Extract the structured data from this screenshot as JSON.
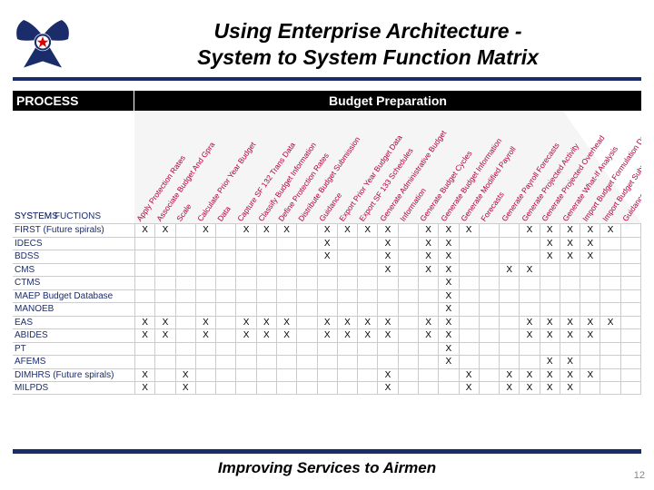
{
  "title_line1": "Using Enterprise Architecture -",
  "title_line2": "System to System Function Matrix",
  "header_left": "PROCESS",
  "header_right": "Budget Preparation",
  "system_functions_label": "SYSTEM FUCTIONS",
  "systems_label": "SYSTEMS",
  "functions": [
    "Apply Protection Rates",
    "Associate Budget And Gpra",
    "Scale",
    "Calculate Prior Year Budget",
    "Data",
    "Capture SF 132 Trans Data",
    "Classify Budget Information",
    "Define Protection Rates",
    "Distribute Budget Submission",
    "Guidance",
    "Export Prior Year Budget Data",
    "Export SF 133 Schedules",
    "Generate Administrative Budget",
    "Information",
    "Generate Budget Cycles",
    "Generate Budget Information",
    "Generate Modified Payroll",
    "Forecasts",
    "Generate Payroll Forecasts",
    "Generate Projected Activity",
    "Generate Projected Overhead",
    "Generate What-If Analysis",
    "Import Budget Formulation Data",
    "Import Budget Submission",
    "Guidance"
  ],
  "systems": [
    {
      "name": "FIRST (Future spirals)",
      "marks": [
        1,
        1,
        0,
        1,
        0,
        1,
        1,
        1,
        0,
        1,
        1,
        1,
        1,
        0,
        1,
        1,
        1,
        0,
        0,
        1,
        1,
        1,
        1,
        1,
        0
      ]
    },
    {
      "name": "IDECS",
      "marks": [
        0,
        0,
        0,
        0,
        0,
        0,
        0,
        0,
        0,
        1,
        0,
        0,
        1,
        0,
        1,
        1,
        0,
        0,
        0,
        0,
        1,
        1,
        1,
        0,
        0
      ]
    },
    {
      "name": "BDSS",
      "marks": [
        0,
        0,
        0,
        0,
        0,
        0,
        0,
        0,
        0,
        1,
        0,
        0,
        1,
        0,
        1,
        1,
        0,
        0,
        0,
        0,
        1,
        1,
        1,
        0,
        0
      ]
    },
    {
      "name": "CMS",
      "marks": [
        0,
        0,
        0,
        0,
        0,
        0,
        0,
        0,
        0,
        0,
        0,
        0,
        1,
        0,
        1,
        1,
        0,
        0,
        1,
        1,
        0,
        0,
        0,
        0,
        0
      ]
    },
    {
      "name": "CTMS",
      "marks": [
        0,
        0,
        0,
        0,
        0,
        0,
        0,
        0,
        0,
        0,
        0,
        0,
        0,
        0,
        0,
        1,
        0,
        0,
        0,
        0,
        0,
        0,
        0,
        0,
        0
      ]
    },
    {
      "name": "MAEP Budget Database",
      "marks": [
        0,
        0,
        0,
        0,
        0,
        0,
        0,
        0,
        0,
        0,
        0,
        0,
        0,
        0,
        0,
        1,
        0,
        0,
        0,
        0,
        0,
        0,
        0,
        0,
        0
      ]
    },
    {
      "name": "MANOEB",
      "marks": [
        0,
        0,
        0,
        0,
        0,
        0,
        0,
        0,
        0,
        0,
        0,
        0,
        0,
        0,
        0,
        1,
        0,
        0,
        0,
        0,
        0,
        0,
        0,
        0,
        0
      ]
    },
    {
      "name": "EAS",
      "marks": [
        1,
        1,
        0,
        1,
        0,
        1,
        1,
        1,
        0,
        1,
        1,
        1,
        1,
        0,
        1,
        1,
        0,
        0,
        0,
        1,
        1,
        1,
        1,
        1,
        0
      ]
    },
    {
      "name": "ABIDES",
      "marks": [
        1,
        1,
        0,
        1,
        0,
        1,
        1,
        1,
        0,
        1,
        1,
        1,
        1,
        0,
        1,
        1,
        0,
        0,
        0,
        1,
        1,
        1,
        1,
        0,
        0
      ]
    },
    {
      "name": "PT",
      "marks": [
        0,
        0,
        0,
        0,
        0,
        0,
        0,
        0,
        0,
        0,
        0,
        0,
        0,
        0,
        0,
        1,
        0,
        0,
        0,
        0,
        0,
        0,
        0,
        0,
        0
      ]
    },
    {
      "name": "AFEMS",
      "marks": [
        0,
        0,
        0,
        0,
        0,
        0,
        0,
        0,
        0,
        0,
        0,
        0,
        0,
        0,
        0,
        1,
        0,
        0,
        0,
        0,
        1,
        1,
        0,
        0,
        0
      ]
    },
    {
      "name": "DIMHRS (Future spirals)",
      "marks": [
        1,
        0,
        1,
        0,
        0,
        0,
        0,
        0,
        0,
        0,
        0,
        0,
        1,
        0,
        0,
        0,
        1,
        0,
        1,
        1,
        1,
        1,
        1,
        0,
        0
      ]
    },
    {
      "name": "MILPDS",
      "marks": [
        1,
        0,
        1,
        0,
        0,
        0,
        0,
        0,
        0,
        0,
        0,
        0,
        1,
        0,
        0,
        0,
        1,
        0,
        1,
        1,
        1,
        1,
        0,
        0,
        0
      ]
    }
  ],
  "footer": "Improving Services to Airmen",
  "page_number": "12",
  "colors": {
    "accent": "#1b2c6b",
    "fn": "#b3003b"
  }
}
